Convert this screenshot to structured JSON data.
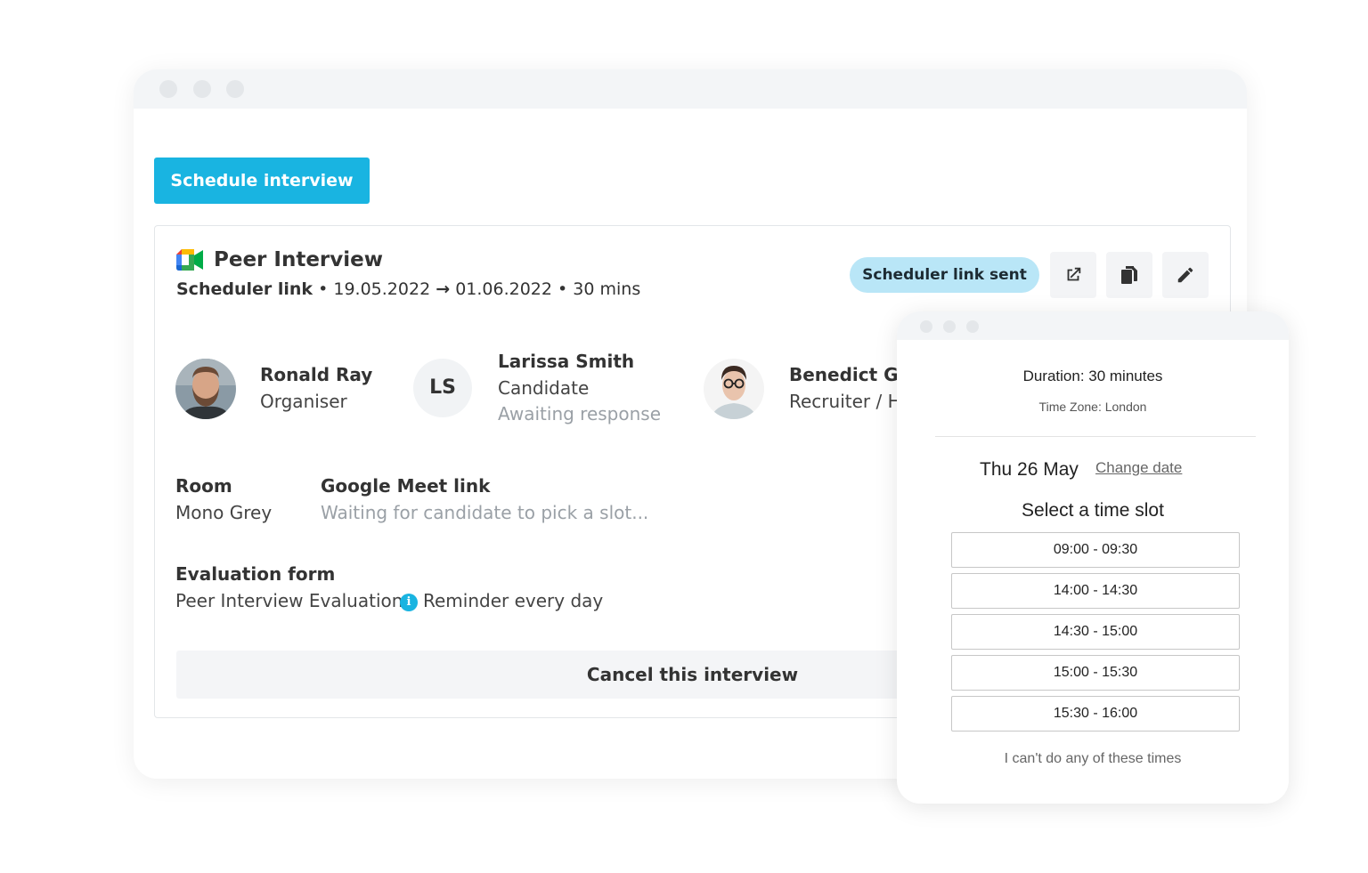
{
  "main": {
    "schedule_button": "Schedule interview",
    "card": {
      "title": "Peer Interview",
      "subtitle": {
        "type": "Scheduler link",
        "bullet": "•",
        "start_date": "19.05.2022",
        "arrow": "→",
        "end_date": "01.06.2022",
        "duration": "30 mins"
      },
      "status_badge": "Scheduler link sent",
      "participants": [
        {
          "name": "Ronald Ray",
          "role": "Organiser"
        },
        {
          "initials": "LS",
          "name": "Larissa Smith",
          "role": "Candidate",
          "status": "Awaiting response"
        },
        {
          "name": "Benedict Go",
          "role": "Recruiter / H"
        }
      ],
      "room": {
        "label": "Room",
        "value": "Mono Grey"
      },
      "meet": {
        "label": "Google Meet link",
        "value": "Waiting for candidate to pick a slot..."
      },
      "evaluation": {
        "label": "Evaluation form",
        "value": "Peer Interview Evaluation",
        "reminder": "Reminder every day"
      },
      "cancel_button": "Cancel this interview"
    }
  },
  "popup": {
    "duration": "Duration: 30 minutes",
    "timezone": "Time Zone: London",
    "date": "Thu 26 May",
    "change_date": "Change date",
    "select_title": "Select a time slot",
    "slots": [
      "09:00 - 09:30",
      "14:00 - 14:30",
      "14:30 - 15:00",
      "15:00 - 15:30",
      "15:30 - 16:00"
    ],
    "cant_do": "I can't do any of these times"
  },
  "icons": {
    "external_link": "external-link-icon",
    "copy": "copy-icon",
    "edit": "pencil-icon",
    "info": "info-icon",
    "meet": "google-meet-icon"
  },
  "colors": {
    "primary": "#19b4e1",
    "badge_bg": "#b9e6f7",
    "muted_text": "#9aa0a6"
  }
}
